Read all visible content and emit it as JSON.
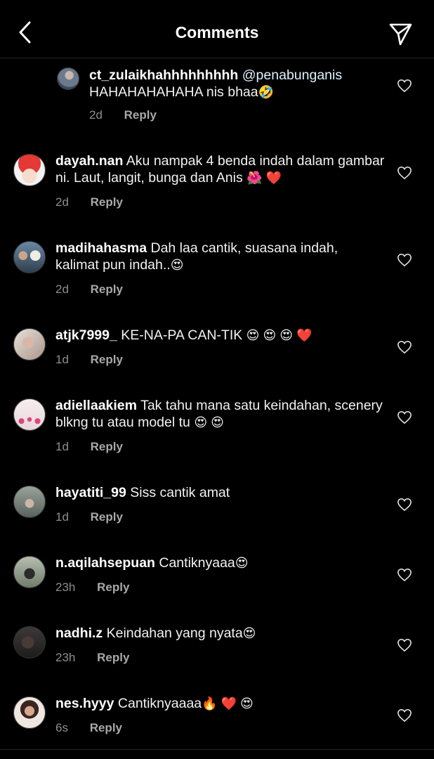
{
  "header": {
    "title": "Comments"
  },
  "comments": [
    {
      "username": "ct_zulaikhahhhhhhhhh",
      "mention": "@penabunganis",
      "text": "HAHAHAHAHAHA nis bhaa",
      "emoji": "🤣",
      "time": "2d",
      "reply": "Reply"
    },
    {
      "username": "dayah.nan",
      "text": "Aku nampak 4 benda indah dalam gambar ni. Laut, langit, bunga dan Anis",
      "emoji": "🌺 ❤️",
      "time": "2d",
      "reply": "Reply"
    },
    {
      "username": "madihahasma",
      "text": "Dah laa cantik, suasana indah, kalimat pun indah..",
      "emoji": "😍",
      "time": "2d",
      "reply": "Reply"
    },
    {
      "username": "atjk7999_",
      "text": "KE-NA-PA CAN-TIK",
      "emoji": "😍 😍 😍 ❤️",
      "time": "1d",
      "reply": "Reply"
    },
    {
      "username": "adiellaakiem",
      "text": "Tak tahu mana satu keindahan, scenery blkng tu atau model tu",
      "emoji": "😍 😍",
      "time": "1d",
      "reply": "Reply"
    },
    {
      "username": "hayatiti_99",
      "text": "Siss cantik amat",
      "emoji": "",
      "time": "1d",
      "reply": "Reply"
    },
    {
      "username": "n.aqilahsepuan",
      "text": "Cantiknyaaa",
      "emoji": "😍",
      "time": "23h",
      "reply": "Reply"
    },
    {
      "username": "nadhi.z",
      "text": "Keindahan yang nyata",
      "emoji": "😍",
      "time": "23h",
      "reply": "Reply"
    },
    {
      "username": "nes.hyyy",
      "text": "Cantiknyaaaa",
      "emoji": "🔥 ❤️ 😍",
      "time": "6s",
      "reply": "Reply"
    }
  ],
  "colors": {
    "background": "#000000",
    "text": "#f5f5f5",
    "muted": "#8e8e8e",
    "divider": "#262626"
  },
  "icons": {
    "back": "chevron-left-icon",
    "send": "paper-plane-icon",
    "like": "heart-outline-icon"
  }
}
